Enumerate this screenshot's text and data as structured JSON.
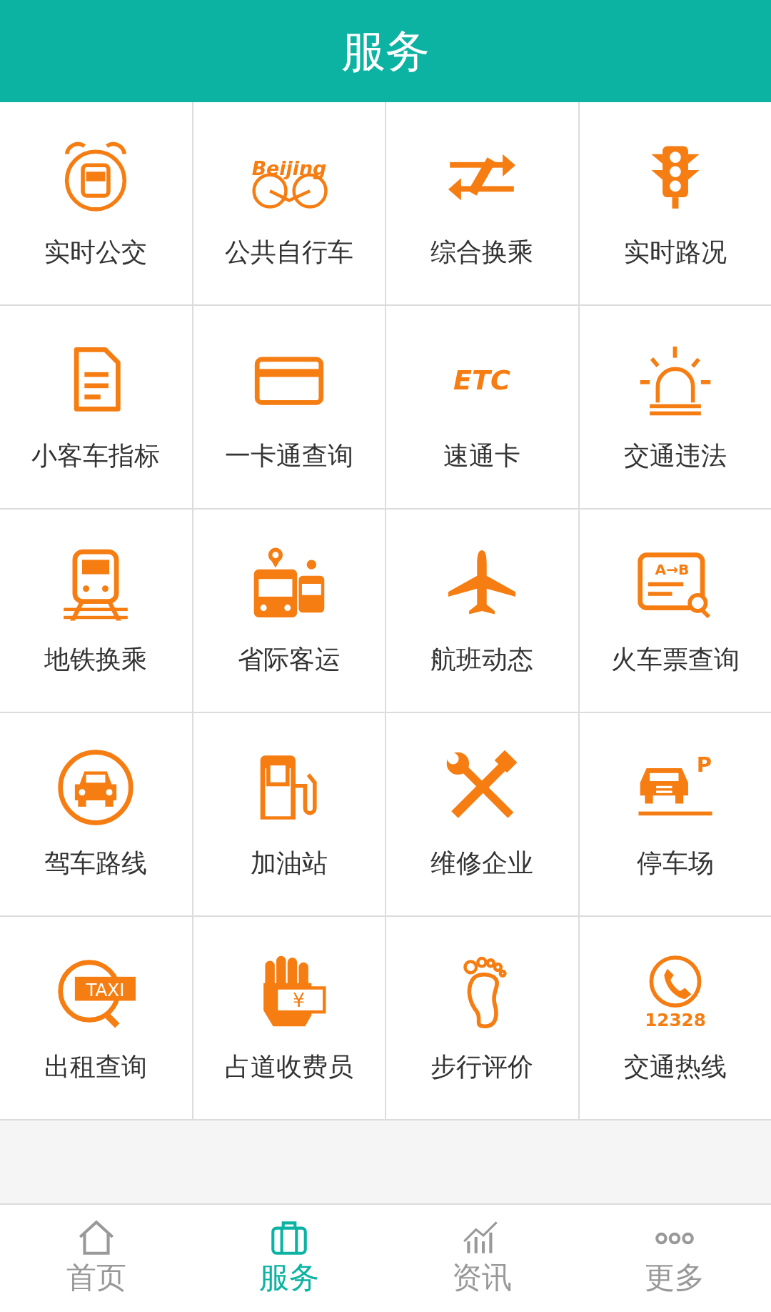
{
  "header": {
    "title": "服务"
  },
  "services": [
    {
      "label": "实时公交"
    },
    {
      "label": "公共自行车",
      "icon_text": "Beijing"
    },
    {
      "label": "综合换乘"
    },
    {
      "label": "实时路况"
    },
    {
      "label": "小客车指标"
    },
    {
      "label": "一卡通查询"
    },
    {
      "label": "速通卡",
      "icon_text": "ETC"
    },
    {
      "label": "交通违法"
    },
    {
      "label": "地铁换乘"
    },
    {
      "label": "省际客运"
    },
    {
      "label": "航班动态"
    },
    {
      "label": "火车票查询",
      "icon_text": "A→B"
    },
    {
      "label": "驾车路线"
    },
    {
      "label": "加油站"
    },
    {
      "label": "维修企业"
    },
    {
      "label": "停车场",
      "icon_text": "P"
    },
    {
      "label": "出租查询",
      "icon_text": "TAXI"
    },
    {
      "label": "占道收费员",
      "icon_text": "¥"
    },
    {
      "label": "步行评价"
    },
    {
      "label": "交通热线",
      "icon_text": "12328"
    }
  ],
  "tabs": [
    {
      "label": "首页",
      "selected": false
    },
    {
      "label": "服务",
      "selected": true
    },
    {
      "label": "资讯",
      "selected": false
    },
    {
      "label": "更多",
      "selected": false
    }
  ]
}
